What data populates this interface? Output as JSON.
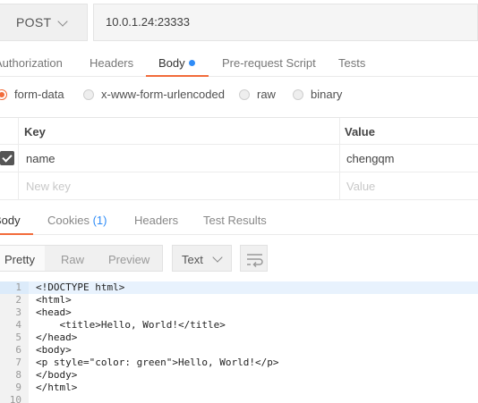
{
  "request": {
    "method": "POST",
    "url": "10.0.1.24:23333"
  },
  "request_tabs": [
    {
      "label": "Authorization"
    },
    {
      "label": "Headers"
    },
    {
      "label": "Body"
    },
    {
      "label": "Pre-request Script"
    },
    {
      "label": "Tests"
    }
  ],
  "body_modes": [
    {
      "label": "form-data",
      "checked": true
    },
    {
      "label": "x-www-form-urlencoded",
      "checked": false
    },
    {
      "label": "raw",
      "checked": false
    },
    {
      "label": "binary",
      "checked": false
    }
  ],
  "params": {
    "key_header": "Key",
    "value_header": "Value",
    "rows": [
      {
        "key": "name",
        "value": "chengqm",
        "enabled": true
      }
    ],
    "new_key_placeholder": "New key",
    "new_value_placeholder": "Value"
  },
  "response_tabs": [
    {
      "label": "Body"
    },
    {
      "label": "Cookies",
      "count": "(1)"
    },
    {
      "label": "Headers"
    },
    {
      "label": "Test Results"
    }
  ],
  "view_modes": [
    "Pretty",
    "Raw",
    "Preview"
  ],
  "format": "Text",
  "code_lines": [
    {
      "num": "1",
      "text": "<!DOCTYPE html>"
    },
    {
      "num": "2",
      "text": "<html>"
    },
    {
      "num": "3",
      "text": "<head>"
    },
    {
      "num": "4",
      "text": "    <title>Hello, World!</title>"
    },
    {
      "num": "5",
      "text": "</head>"
    },
    {
      "num": "6",
      "text": "<body>"
    },
    {
      "num": "7",
      "text": "<p style=\"color: green\">Hello, World!</p>"
    },
    {
      "num": "8",
      "text": "</body>"
    },
    {
      "num": "9",
      "text": "</html>"
    },
    {
      "num": "10",
      "text": ""
    }
  ],
  "colors": {
    "accent": "#f26b3a",
    "dot": "#2f8cf7",
    "line_highlight": "#e8f2fd"
  }
}
